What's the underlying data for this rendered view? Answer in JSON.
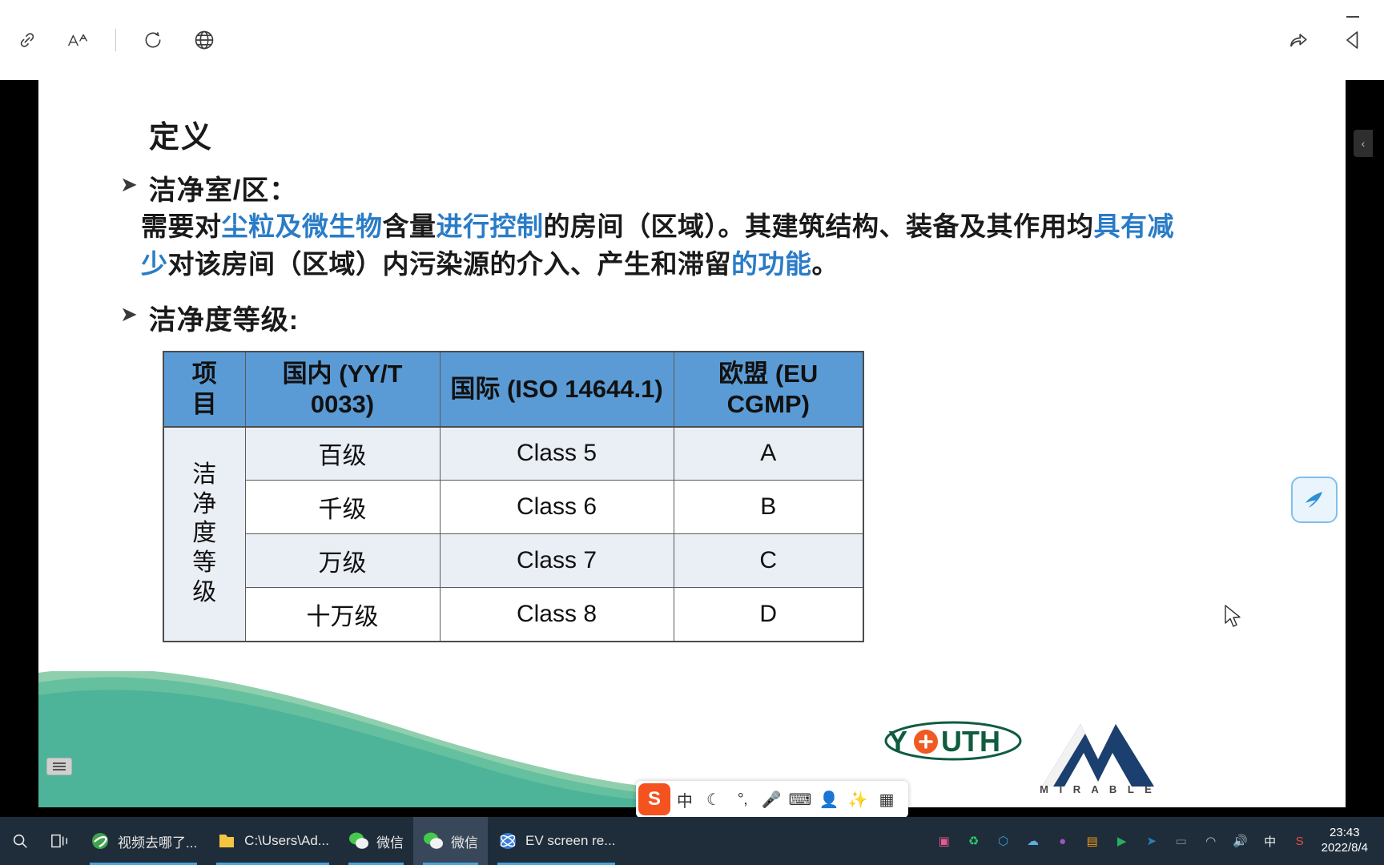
{
  "toolbar": {
    "icons": [
      {
        "name": "link-icon",
        "glyph": "link"
      },
      {
        "name": "font-size-icon",
        "glyph": "AA"
      },
      {
        "name": "refresh-icon",
        "glyph": "refresh"
      },
      {
        "name": "globe-icon",
        "glyph": "globe"
      }
    ],
    "right_icons": [
      {
        "name": "share-icon",
        "glyph": "share"
      },
      {
        "name": "clip-icon",
        "glyph": "clip"
      }
    ],
    "minimize_label": "—"
  },
  "slide": {
    "title": "定义",
    "bullet_marker": "➤",
    "bullet1": "洁净室/区：",
    "bullet2": "洁净度等级:",
    "paragraph": [
      {
        "t": "需要对",
        "hl": false
      },
      {
        "t": "尘粒及微生物",
        "hl": true
      },
      {
        "t": "含量",
        "hl": false
      },
      {
        "t": "进行控制",
        "hl": true
      },
      {
        "t": "的房间（区域）。其建筑结构、装备及其作用均",
        "hl": false
      },
      {
        "t": "具有减少",
        "hl": true
      },
      {
        "t": "对该房间（区域）内污染源的介入、产生和滞留",
        "hl": false
      },
      {
        "t": "的功能",
        "hl": true
      },
      {
        "t": "。",
        "hl": false
      }
    ],
    "highlight_color": "#2a7cc7"
  },
  "table": {
    "header_bg": "#5b9bd5",
    "rowhead_bg": "#dce6f1",
    "columns": [
      {
        "title": "项目",
        "code": ""
      },
      {
        "title": "国内",
        "code": "(YY/T 0033)"
      },
      {
        "title": "国际",
        "code": "(ISO 14644.1)"
      },
      {
        "title": "欧盟",
        "code": "(EU CGMP)"
      }
    ],
    "row_header": "洁净度等级",
    "rows": [
      {
        "domestic": "百级",
        "international": "Class 5",
        "eu": "A"
      },
      {
        "domestic": "千级",
        "international": "Class 6",
        "eu": "B"
      },
      {
        "domestic": "万级",
        "international": "Class 7",
        "eu": "C"
      },
      {
        "domestic": "十万级",
        "international": "Class 8",
        "eu": "D"
      }
    ]
  },
  "logos": {
    "youth_text": "YOUTH",
    "mirable_text": "M I R A B L E"
  },
  "ime": {
    "logo_label": "S",
    "items": [
      {
        "name": "chinese-mode-icon",
        "glyph": "中"
      },
      {
        "name": "moon-icon",
        "glyph": "☾"
      },
      {
        "name": "punctuation-icon",
        "glyph": "°‚"
      },
      {
        "name": "microphone-icon",
        "glyph": "🎤"
      },
      {
        "name": "keyboard-icon",
        "glyph": "⌨"
      },
      {
        "name": "user-icon",
        "glyph": "👤"
      },
      {
        "name": "bowtie-icon",
        "glyph": "✨"
      },
      {
        "name": "apps-icon",
        "glyph": "▦"
      }
    ]
  },
  "taskbar": {
    "search_icon": "search-icon",
    "taskview_icon": "task-view-icon",
    "items": [
      {
        "name": "taskbar-item-video",
        "label": "视频去哪了...",
        "icon": "ie-icon",
        "active": false,
        "underline": true
      },
      {
        "name": "taskbar-item-explorer",
        "label": "C:\\Users\\Ad...",
        "icon": "folder-icon",
        "active": false,
        "underline": true
      },
      {
        "name": "taskbar-item-wechat-1",
        "label": "微信",
        "icon": "wechat-icon",
        "active": false,
        "underline": true
      },
      {
        "name": "taskbar-item-wechat-2",
        "label": "微信",
        "icon": "wechat-icon",
        "active": true,
        "underline": true
      },
      {
        "name": "taskbar-item-ev",
        "label": "EV screen re...",
        "icon": "ev-icon",
        "active": false,
        "underline": true
      }
    ],
    "tray": [
      {
        "name": "tray-camera-icon",
        "glyph": "▣",
        "color": "#e8598c"
      },
      {
        "name": "tray-recycle-icon",
        "glyph": "♻",
        "color": "#2ecc71"
      },
      {
        "name": "tray-shield-icon",
        "glyph": "⬡",
        "color": "#3498db"
      },
      {
        "name": "tray-cloud-icon",
        "glyph": "☁",
        "color": "#5dade2"
      },
      {
        "name": "tray-disc-icon",
        "glyph": "●",
        "color": "#9b59b6"
      },
      {
        "name": "tray-note-icon",
        "glyph": "▤",
        "color": "#f39c12"
      },
      {
        "name": "tray-video-icon",
        "glyph": "▶",
        "color": "#27ae60"
      },
      {
        "name": "tray-browser-icon",
        "glyph": "➤",
        "color": "#2980b9"
      },
      {
        "name": "tray-window-icon",
        "glyph": "▭",
        "color": "#7f8c8d"
      },
      {
        "name": "tray-network-icon",
        "glyph": "◠",
        "color": "#bdc3c7"
      },
      {
        "name": "tray-volume-icon",
        "glyph": "🔊",
        "color": "#ecf0f1"
      },
      {
        "name": "tray-ime-icon",
        "glyph": "中",
        "color": "#ecf0f1"
      },
      {
        "name": "tray-sogou-icon",
        "glyph": "S",
        "color": "#e74c3c"
      }
    ],
    "clock_time": "23:43",
    "clock_date": "2022/8/4"
  }
}
